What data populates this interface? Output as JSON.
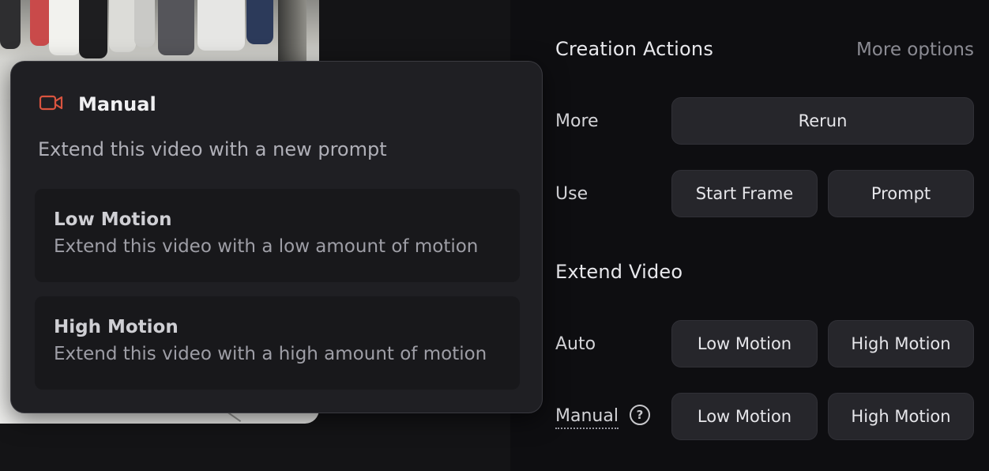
{
  "panel": {
    "creation_actions_title": "Creation Actions",
    "more_options": "More options",
    "more_label": "More",
    "rerun_button": "Rerun",
    "use_label": "Use",
    "start_frame_button": "Start Frame",
    "prompt_button": "Prompt",
    "extend_video_title": "Extend Video",
    "auto_label": "Auto",
    "auto_low_motion": "Low Motion",
    "auto_high_motion": "High Motion",
    "manual_label": "Manual",
    "help_symbol": "?",
    "manual_low_motion": "Low Motion",
    "manual_high_motion": "High Motion"
  },
  "popup": {
    "icon": "video-camera-icon",
    "title": "Manual",
    "description": "Extend this video with a new prompt",
    "options": [
      {
        "title": "Low Motion",
        "description": "Extend this video with a low amount of motion"
      },
      {
        "title": "High Motion",
        "description": "Extend this video with a high amount of motion"
      }
    ]
  },
  "colors": {
    "accent_icon": "#d9543f",
    "button_bg": "#26262b",
    "panel_bg": "#0e0e11",
    "popup_bg": "#1f1f23"
  }
}
